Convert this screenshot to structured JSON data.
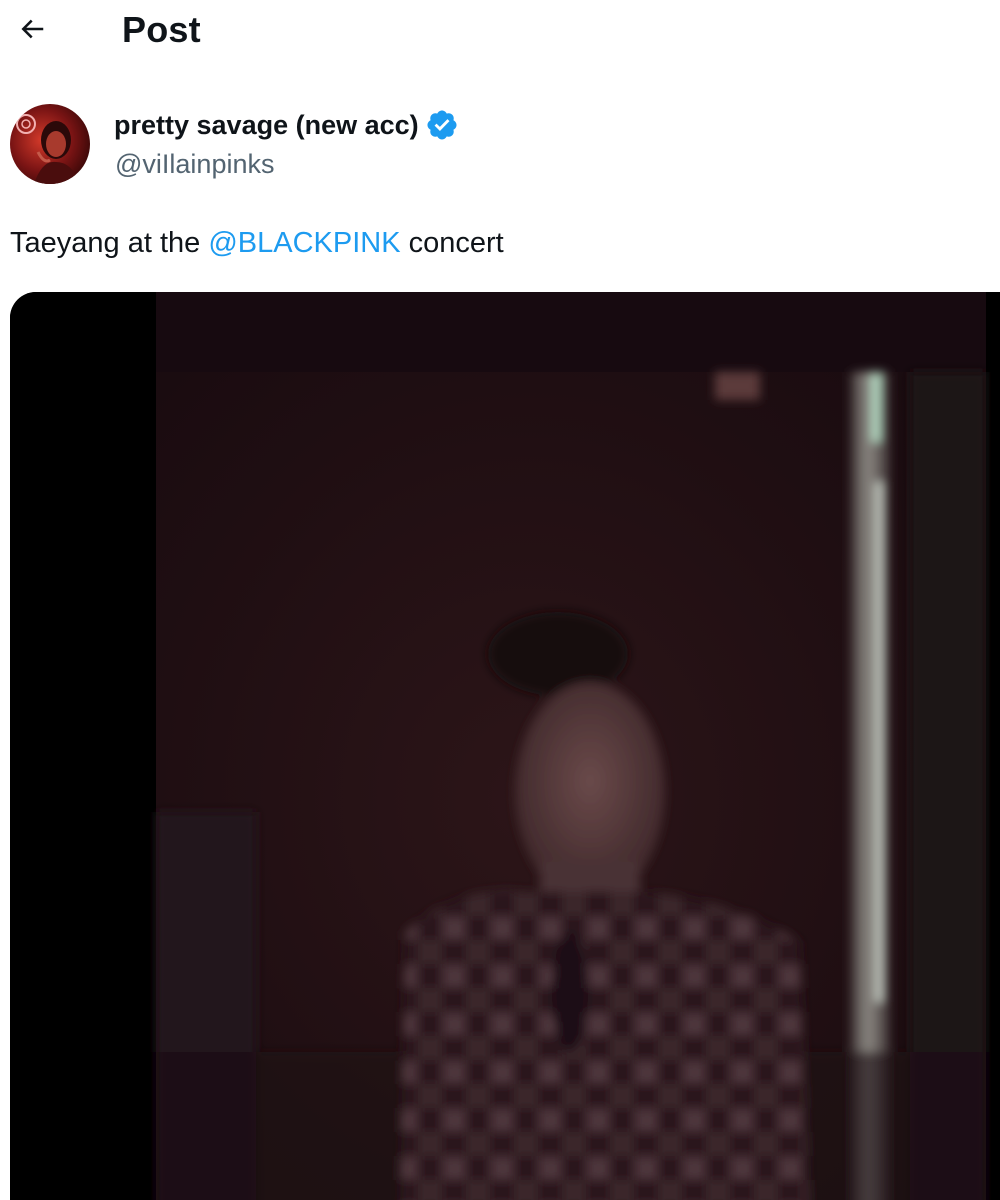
{
  "header": {
    "back_icon": "arrow-left-icon",
    "title": "Post"
  },
  "author": {
    "display_name": "pretty savage (new acc)",
    "verified_icon": "verified-badge-icon",
    "handle": "@viIlainpinks"
  },
  "tweet": {
    "text_before": "Taeyang at the ",
    "mention": "@BLACKPINK",
    "text_after": " concert"
  },
  "colors": {
    "accent": "#1d9bf0",
    "text_primary": "#0f1419",
    "text_secondary": "#536471"
  }
}
